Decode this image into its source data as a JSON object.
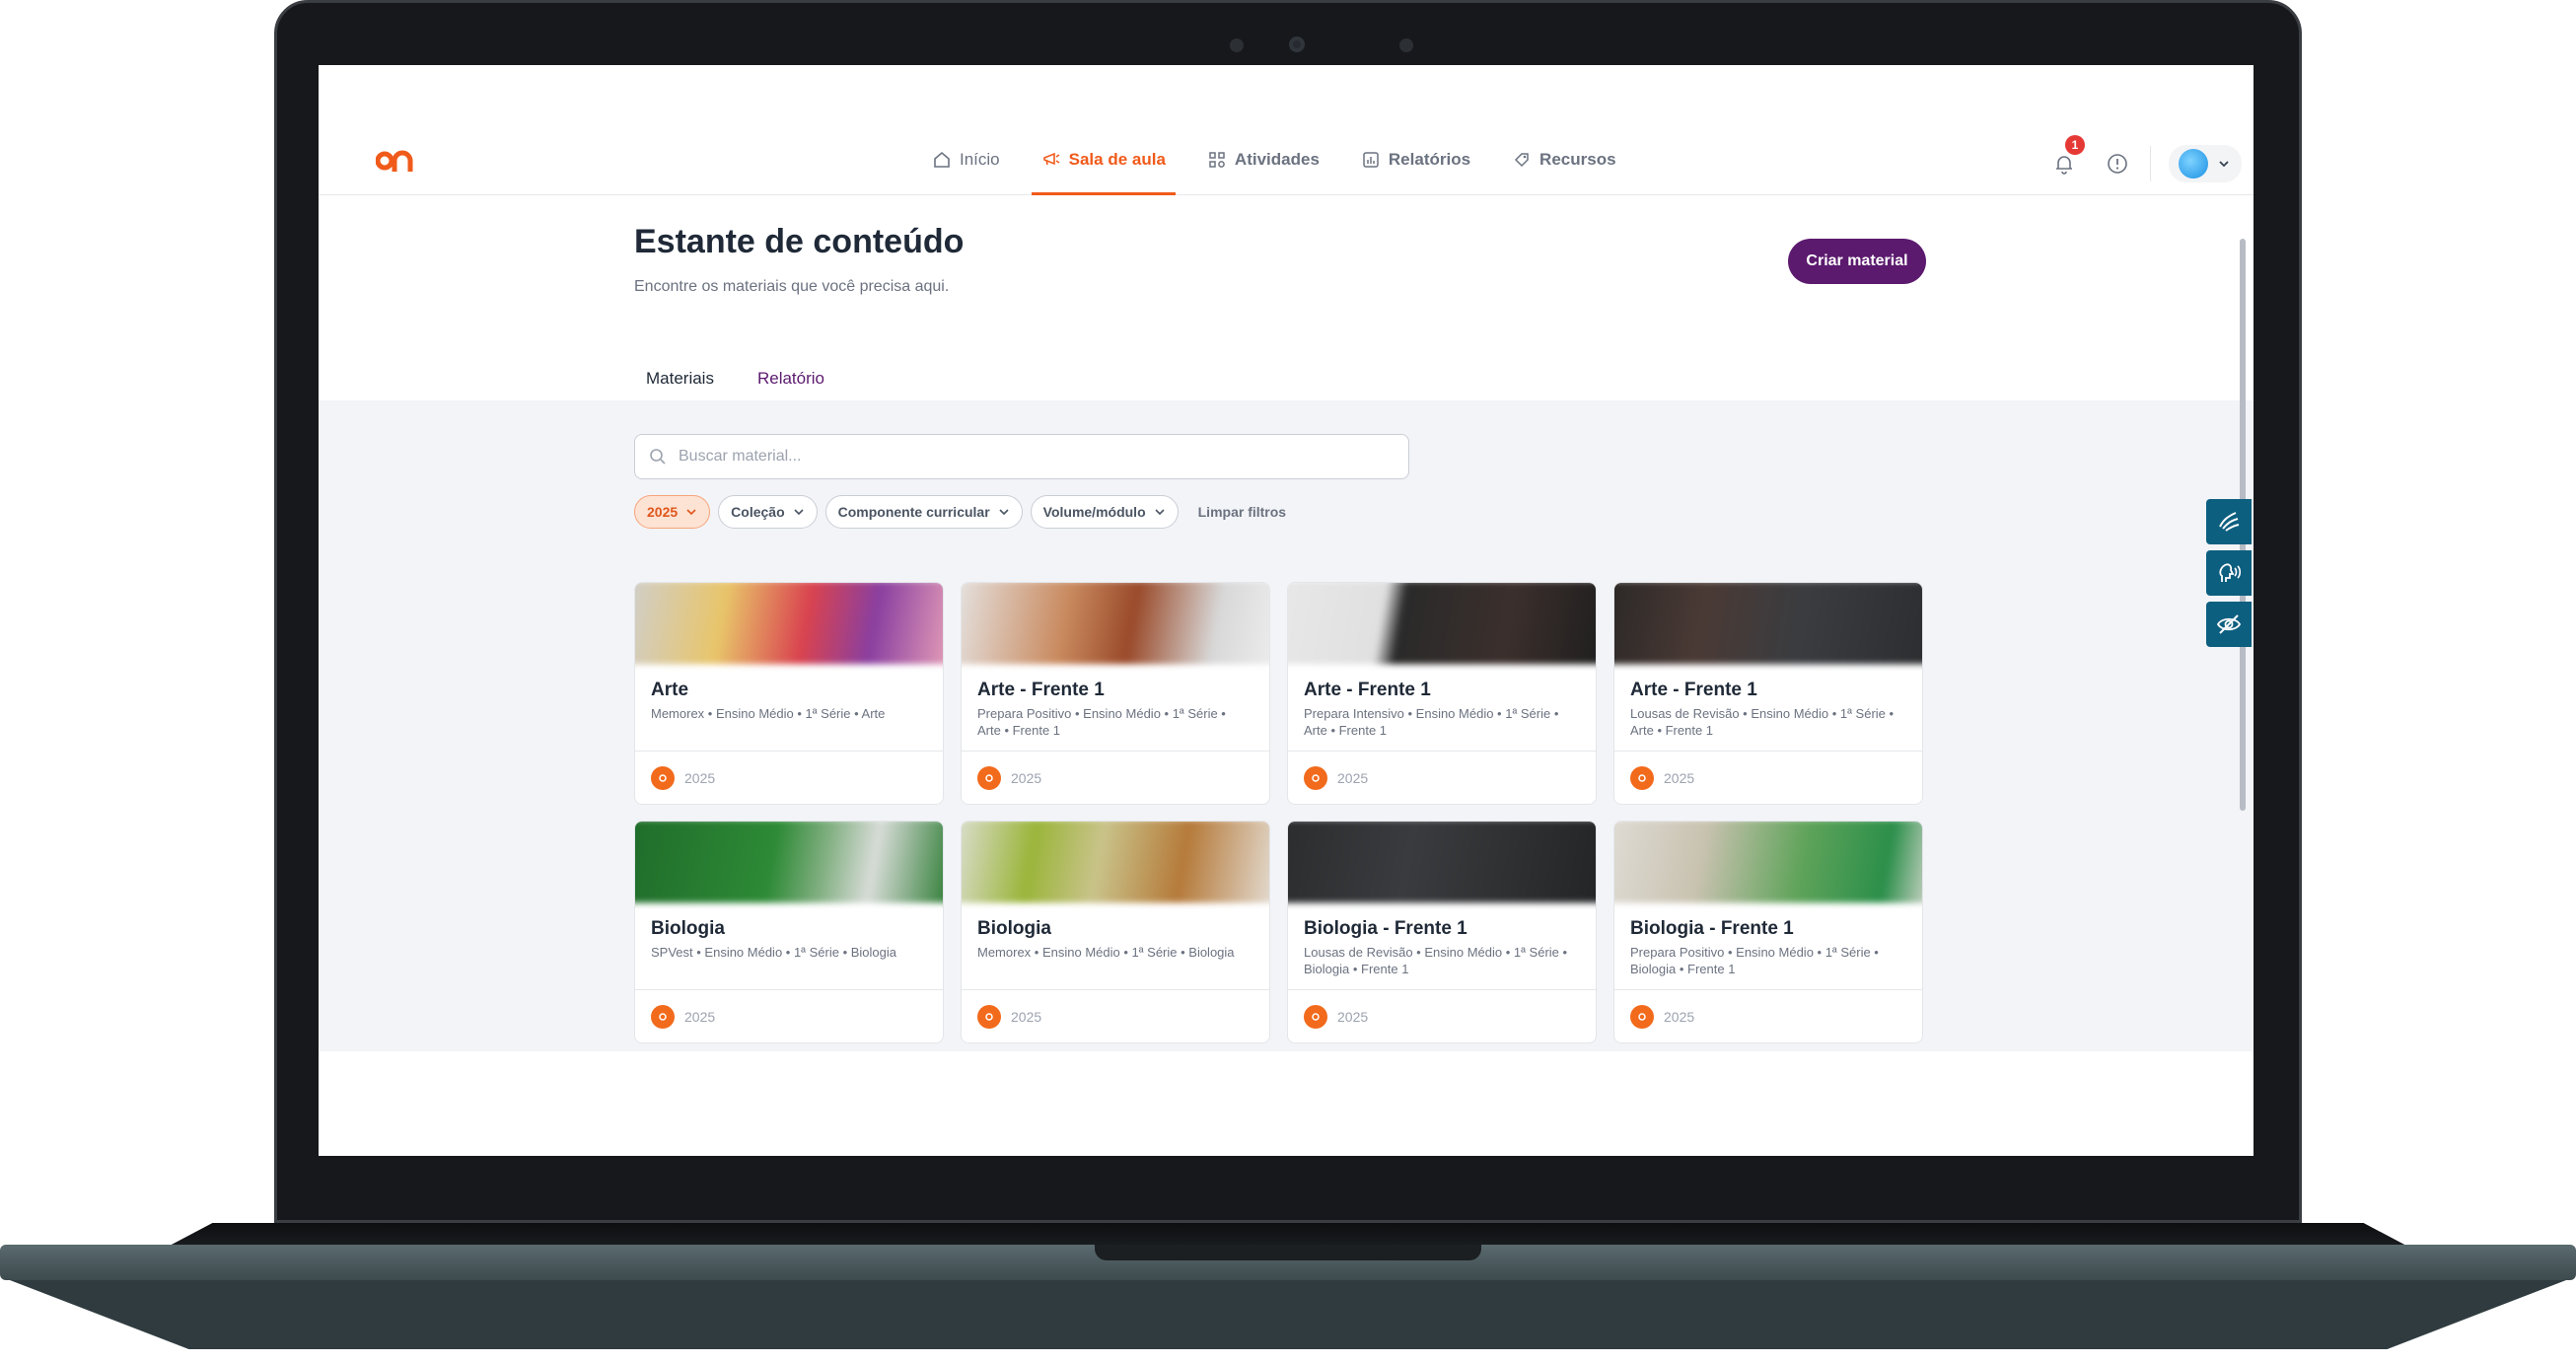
{
  "brand": {
    "accent": "#f05a1a",
    "primary": "#5b1a6e"
  },
  "nav": {
    "items": [
      {
        "label": "Início",
        "icon": "home-icon"
      },
      {
        "label": "Sala de aula",
        "icon": "megaphone-icon"
      },
      {
        "label": "Atividades",
        "icon": "grid-icon"
      },
      {
        "label": "Relatórios",
        "icon": "chart-icon"
      },
      {
        "label": "Recursos",
        "icon": "tag-icon"
      }
    ],
    "active": "Sala de aula",
    "notifications_count": "1"
  },
  "page": {
    "title": "Estante de conteúdo",
    "subtitle": "Encontre os materiais que você precisa aqui.",
    "create_label": "Criar material"
  },
  "tabs": [
    {
      "label": "Materiais"
    },
    {
      "label": "Relatório"
    }
  ],
  "search": {
    "placeholder": "Buscar material..."
  },
  "filters": {
    "chips": [
      {
        "label": "2025"
      },
      {
        "label": "Coleção"
      },
      {
        "label": "Componente curricular"
      },
      {
        "label": "Volume/módulo"
      }
    ],
    "clear_label": "Limpar filtros"
  },
  "cards": [
    {
      "title": "Arte",
      "desc": "Memorex • Ensino Médio • 1ª Série • Arte",
      "year": "2025"
    },
    {
      "title": "Arte - Frente 1",
      "desc": "Prepara Positivo • Ensino Médio • 1ª Série • Arte • Frente 1",
      "year": "2025"
    },
    {
      "title": "Arte - Frente 1",
      "desc": "Prepara Intensivo • Ensino Médio • 1ª Série • Arte • Frente 1",
      "year": "2025"
    },
    {
      "title": "Arte - Frente 1",
      "desc": "Lousas de Revisão • Ensino Médio • 1ª Série • Arte • Frente 1",
      "year": "2025"
    },
    {
      "title": "Biologia",
      "desc": "SPVest • Ensino Médio • 1ª Série • Biologia",
      "year": "2025"
    },
    {
      "title": "Biologia",
      "desc": "Memorex • Ensino Médio • 1ª Série • Biologia",
      "year": "2025"
    },
    {
      "title": "Biologia - Frente 1",
      "desc": "Lousas de Revisão • Ensino Médio • 1ª Série • Biologia • Frente 1",
      "year": "2025"
    },
    {
      "title": "Biologia - Frente 1",
      "desc": "Prepara Positivo • Ensino Médio • 1ª Série • Biologia • Frente 1",
      "year": "2025"
    }
  ],
  "accessibility": [
    {
      "icon": "sign-language-icon"
    },
    {
      "icon": "voice-reader-icon"
    },
    {
      "icon": "hide-eye-icon"
    }
  ]
}
